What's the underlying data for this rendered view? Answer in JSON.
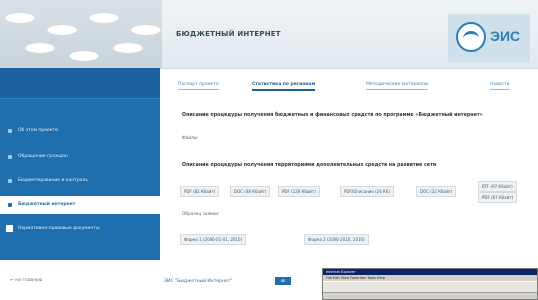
{
  "header": {
    "title": "БЮДЖЕТНЫЙ ИНТЕРНЕТ",
    "logo_text": "ЭИС"
  },
  "sidebar": {
    "items": [
      {
        "label": "Об этом проекте"
      },
      {
        "label": "Обращения граждан"
      },
      {
        "label": "Бюджетирование и контроль"
      },
      {
        "label": "Бюджетный интернет"
      },
      {
        "label": "Нормативно-правовые документы"
      }
    ]
  },
  "tabs": [
    {
      "label": "Паспорт проекта"
    },
    {
      "label": "Статистика по регионам"
    },
    {
      "label": "Методические материалы"
    },
    {
      "label": "Новости"
    }
  ],
  "main": {
    "section1_title": "Описание процедуры получения бюджетных и финансовых средств по программе «Бюджетный интернет»",
    "section1_meta": "Файлы:",
    "section2_title": "Описание процедуры получения территориями дополнительных средств на развитие сети",
    "files": [
      "PDF (82 Кбайт)",
      "DOC (48 Кбайт)",
      "PDF (126 Кбайт)",
      "PDF/Описание (24 Кб)",
      "DOC (32 Кбайт)",
      "RTF (97 Кбайт)",
      "PDF (67 Кбайт)"
    ],
    "sub_label": "Образец заявки:",
    "form_files": [
      "Форма 1 (2006-01-01, 2010)",
      "Форма 2 (2006-2010, 2010)"
    ]
  },
  "footer": {
    "back_label": "← на главную",
    "mid_label": "ЭИС \"Бюджетный Интернет\"",
    "button_label": "ok"
  },
  "thumbnail": {
    "title": "Internet Explorer",
    "menu": "File  Edit  View  Favorites  Tools  Help"
  }
}
